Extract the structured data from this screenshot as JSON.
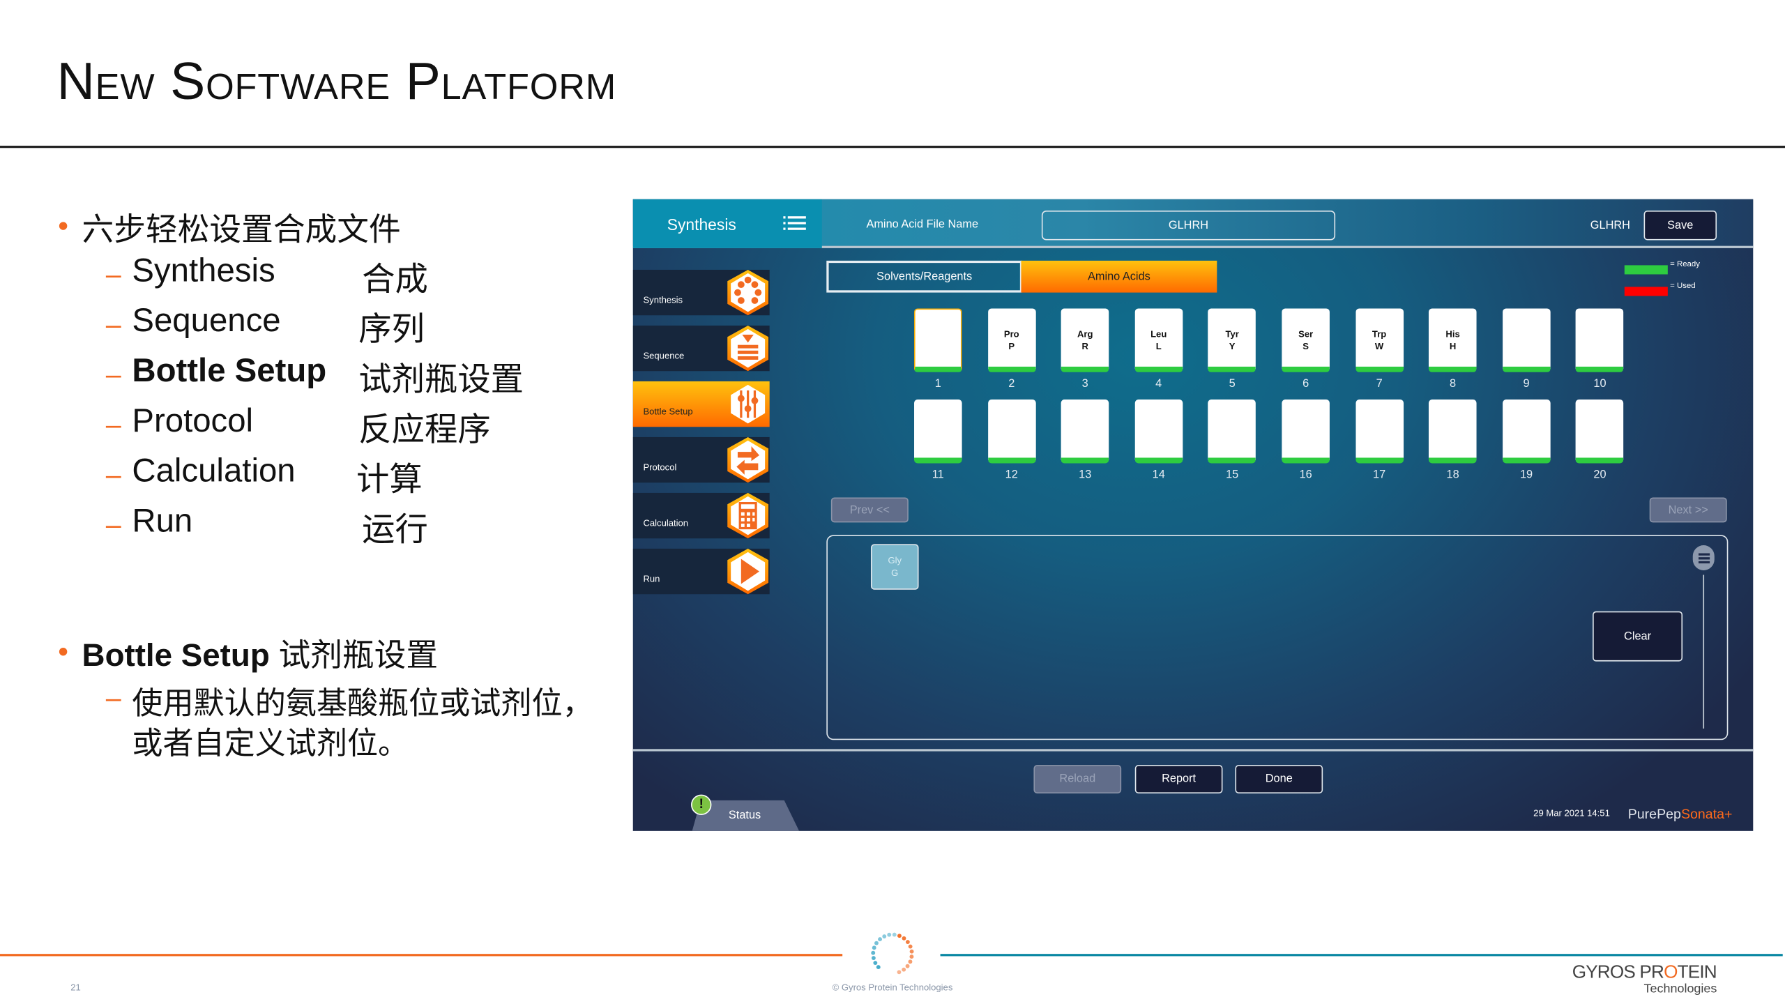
{
  "slide": {
    "title": "New Software Platform",
    "page_number": "21",
    "copyright": "© Gyros Protein Technologies",
    "company_logo": "GYROS PROTEIN Technologies"
  },
  "bullets": [
    {
      "text": "六步轻松设置合成文件",
      "subs": [
        {
          "en": "Synthesis",
          "zh": "合成"
        },
        {
          "en": "Sequence",
          "zh": "序列"
        },
        {
          "en": "Bottle Setup",
          "zh": "试剂瓶设置",
          "bold": true
        },
        {
          "en": "Protocol",
          "zh": "反应程序"
        },
        {
          "en": "Calculation",
          "zh": "计算"
        },
        {
          "en": "Run",
          "zh": "运行"
        }
      ]
    },
    {
      "bold_text": "Bottle Setup",
      "text": "试剂瓶设置",
      "subs": [
        {
          "line1": "使用默认的氨基酸瓶位或试剂位，",
          "line2": "或者自定义试剂位。"
        }
      ]
    }
  ],
  "app": {
    "header": {
      "section": "Synthesis",
      "file_label": "Amino Acid File Name",
      "file_value": "GLHRH",
      "current_file": "GLHRH",
      "save": "Save"
    },
    "sidebar": [
      {
        "label": "Synthesis",
        "icon": "synthesis-icon"
      },
      {
        "label": "Sequence",
        "icon": "sequence-icon"
      },
      {
        "label": "Bottle Setup",
        "icon": "sliders-icon",
        "active": true
      },
      {
        "label": "Protocol",
        "icon": "swap-arrows-icon"
      },
      {
        "label": "Calculation",
        "icon": "calculator-icon"
      },
      {
        "label": "Run",
        "icon": "play-icon"
      }
    ],
    "tabs": [
      {
        "label": "Solvents/Reagents"
      },
      {
        "label": "Amino Acids",
        "active": true
      }
    ],
    "legend": [
      {
        "label": "= Ready",
        "color": "#2ecc40"
      },
      {
        "label": "= Used",
        "color": "#ff0000"
      }
    ],
    "bottles": [
      {
        "n": "1",
        "a": "",
        "b": ""
      },
      {
        "n": "2",
        "a": "Pro",
        "b": "P"
      },
      {
        "n": "3",
        "a": "Arg",
        "b": "R"
      },
      {
        "n": "4",
        "a": "Leu",
        "b": "L"
      },
      {
        "n": "5",
        "a": "Tyr",
        "b": "Y"
      },
      {
        "n": "6",
        "a": "Ser",
        "b": "S"
      },
      {
        "n": "7",
        "a": "Trp",
        "b": "W"
      },
      {
        "n": "8",
        "a": "His",
        "b": "H"
      },
      {
        "n": "9",
        "a": "",
        "b": ""
      },
      {
        "n": "10",
        "a": "",
        "b": ""
      },
      {
        "n": "11",
        "a": "",
        "b": ""
      },
      {
        "n": "12",
        "a": "",
        "b": ""
      },
      {
        "n": "13",
        "a": "",
        "b": ""
      },
      {
        "n": "14",
        "a": "",
        "b": ""
      },
      {
        "n": "15",
        "a": "",
        "b": ""
      },
      {
        "n": "16",
        "a": "",
        "b": ""
      },
      {
        "n": "17",
        "a": "",
        "b": ""
      },
      {
        "n": "18",
        "a": "",
        "b": ""
      },
      {
        "n": "19",
        "a": "",
        "b": ""
      },
      {
        "n": "20",
        "a": "",
        "b": ""
      }
    ],
    "prev": "Prev <<",
    "next": "Next >>",
    "palette": [
      {
        "a": "Gly",
        "b": "G"
      }
    ],
    "clear": "Clear",
    "footer": {
      "reload": "Reload",
      "report": "Report",
      "done": "Done",
      "status": "Status",
      "datetime": "29 Mar 2021 14:51",
      "brand_a": "PurePep",
      "brand_b": "Sonata+"
    },
    "colors": {
      "accent": "#ff8a00",
      "ready": "#2ecc40",
      "used": "#ff0000",
      "header": "#0a8fb0"
    }
  }
}
